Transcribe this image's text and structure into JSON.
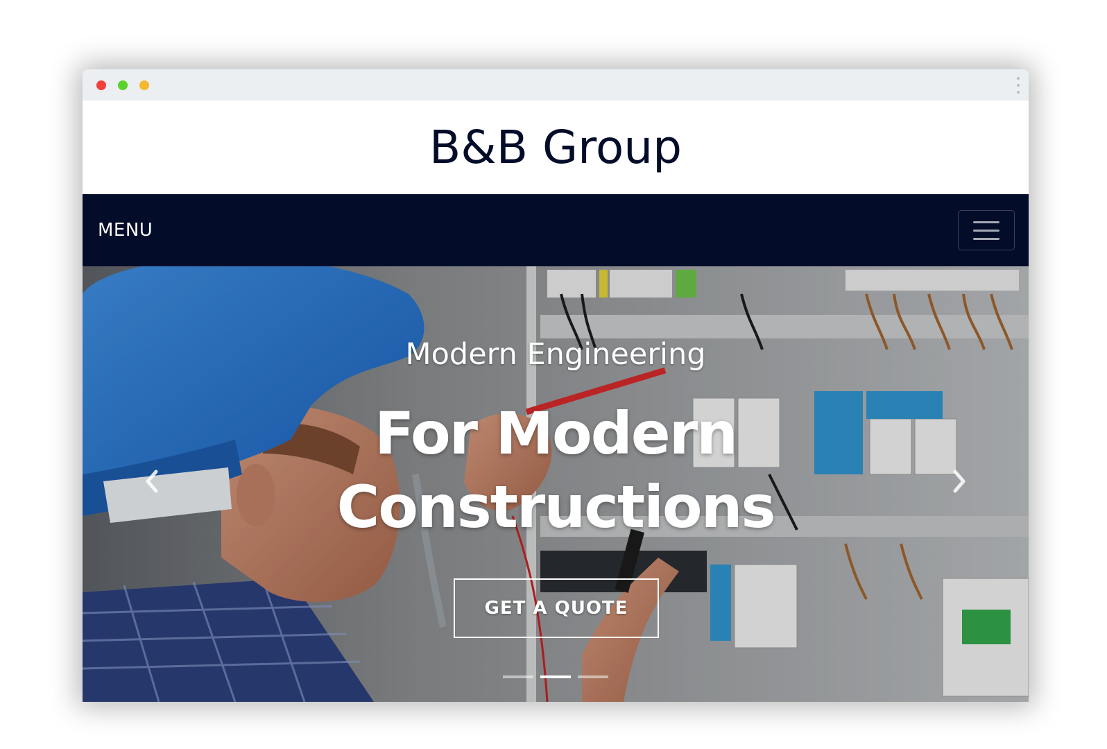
{
  "window": {
    "controls": [
      "close",
      "minimize",
      "maximize"
    ]
  },
  "brand": {
    "title": "B&B Group"
  },
  "navbar": {
    "menu_label": "MENU",
    "toggler_icon": "hamburger-icon"
  },
  "hero": {
    "subheading": "Modern Engineering",
    "heading_line1": "For Modern",
    "heading_line2": "Constructions",
    "cta_label": "GET A QUOTE",
    "prev_icon": "chevron-left-icon",
    "next_icon": "chevron-right-icon",
    "slides_count": 3,
    "active_slide": 2
  },
  "colors": {
    "brand_navy": "#030d2a",
    "titlebar": "#eceff1",
    "close_dot": "#f2403b",
    "minimize_dot": "#5bd12b",
    "maximize_dot": "#f6b730"
  }
}
